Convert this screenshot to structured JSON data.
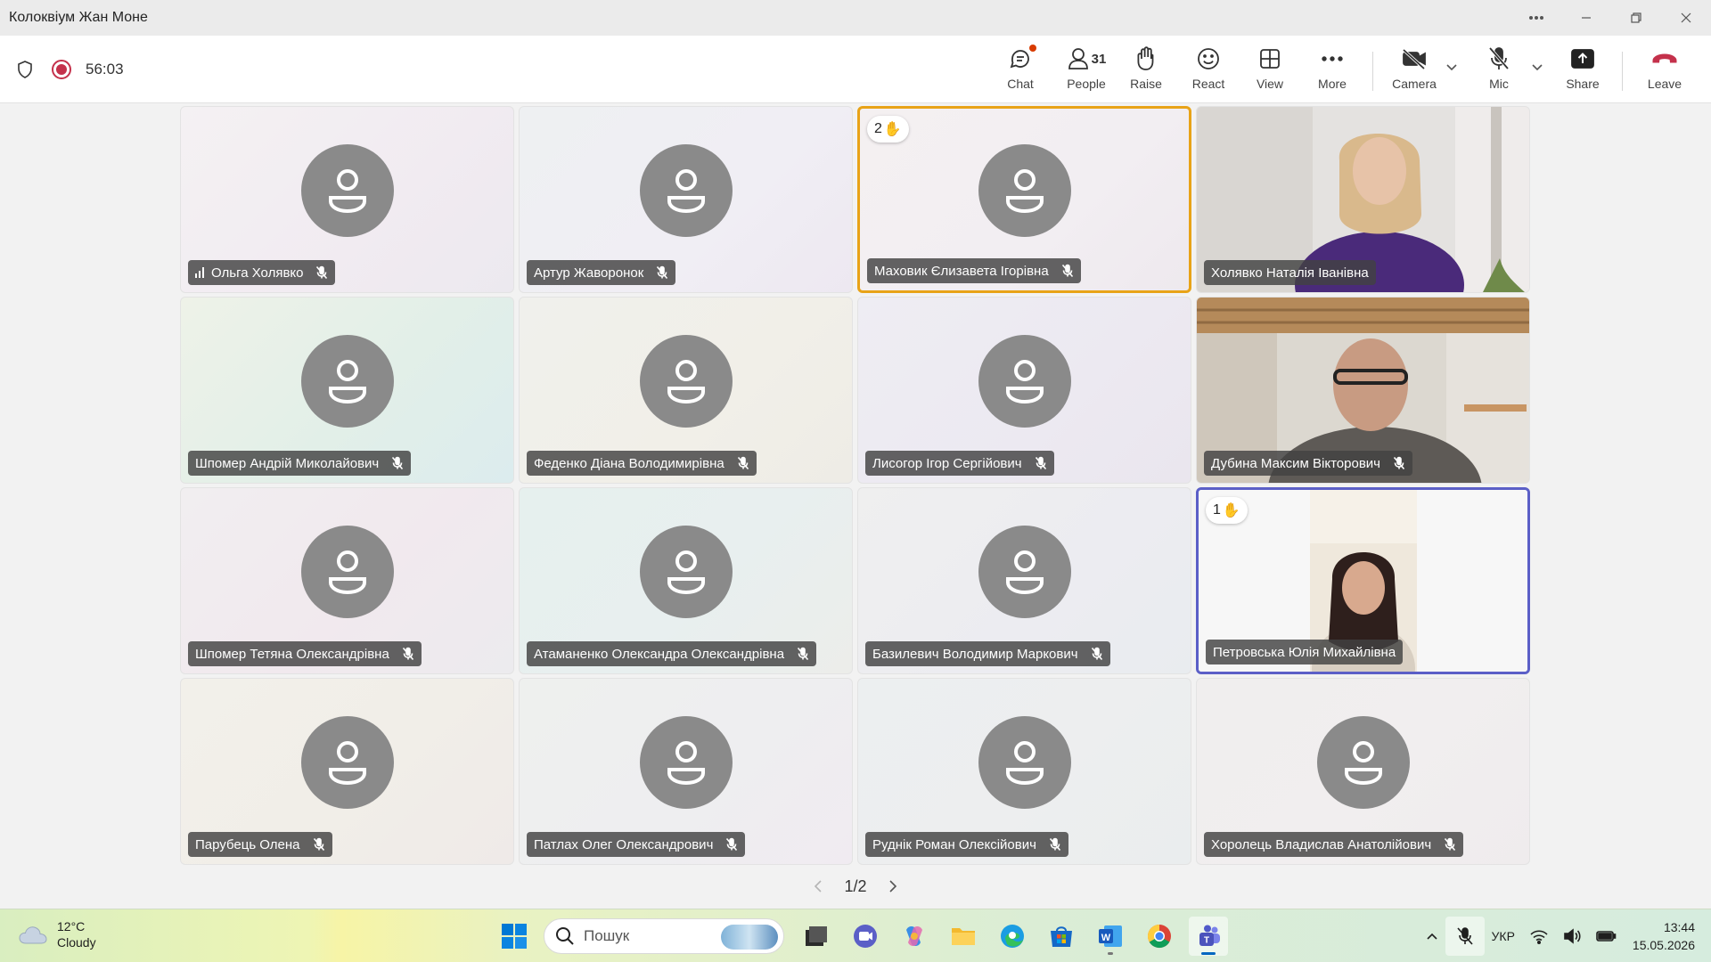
{
  "window": {
    "title": "Колоквіум Жан Моне"
  },
  "meeting": {
    "timer": "56:03",
    "toolbar": {
      "chat": "Chat",
      "people": "People",
      "people_count": "31",
      "raise": "Raise",
      "react": "React",
      "view": "View",
      "more": "More",
      "camera": "Camera",
      "mic": "Mic",
      "share": "Share",
      "leave": "Leave"
    },
    "colors": {
      "leave": "#c4314b",
      "speaking_border": "#e8a317",
      "spotlight_border": "#5b5fc7"
    }
  },
  "participants": [
    {
      "name": "Ольга Холявко"
    },
    {
      "name": "Артур Жаворонок"
    },
    {
      "name": "Маховик Єлизавета Ігорівна",
      "hand": "2"
    },
    {
      "name": "Холявко Наталія Іванівна"
    },
    {
      "name": "Шпомер Андрій Миколайович"
    },
    {
      "name": "Феденко Діана Володимирівна"
    },
    {
      "name": "Лисогор Ігор Сергійович"
    },
    {
      "name": "Дубина Максим Вікторович"
    },
    {
      "name": "Шпомер Тетяна Олександрівна"
    },
    {
      "name": "Атаманенко Олександра Олександрівна"
    },
    {
      "name": "Базилевич Володимир Маркович"
    },
    {
      "name": "Петровська Юлія Михайлівна",
      "hand": "1"
    },
    {
      "name": "Парубець Олена"
    },
    {
      "name": "Патлах Олег Олександрович"
    },
    {
      "name": "Руднік Роман Олексійович"
    },
    {
      "name": "Хоролець Владислав Анатолійович"
    }
  ],
  "pager": {
    "label": "1/2"
  },
  "taskbar": {
    "weather_temp": "12°C",
    "weather_desc": "Cloudy",
    "search_placeholder": "Пошук",
    "language": "УКР",
    "time": "13:44",
    "date": "15.05.2026"
  }
}
